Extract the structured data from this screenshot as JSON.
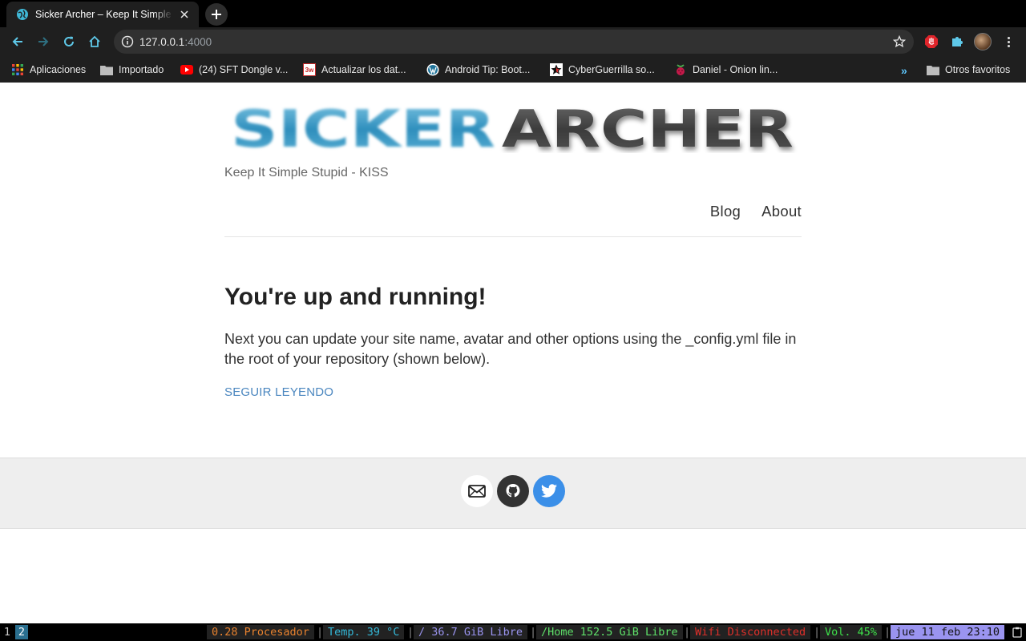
{
  "browser": {
    "tab": {
      "title": "Sicker Archer – Keep It Simple Stupid - KISS"
    },
    "omnibox": {
      "host": "127.0.0.1",
      "port": ":4000"
    },
    "bookmarks": [
      {
        "label": "Aplicaciones",
        "icon": "apps-grid-icon"
      },
      {
        "label": "Importado",
        "icon": "folder-icon"
      },
      {
        "label": "(24) SFT Dongle v...",
        "icon": "youtube-icon"
      },
      {
        "label": "Actualizar los dat...",
        "icon": "3w-icon",
        "icon_text": "3w"
      },
      {
        "label": "Android Tip: Boot...",
        "icon": "wordpress-icon"
      },
      {
        "label": "CyberGuerrilla so...",
        "icon": "star-icon"
      },
      {
        "label": "Daniel - Onion lin...",
        "icon": "raspberry-icon"
      }
    ],
    "other_bookmarks": "Otros favoritos",
    "more_bookmarks": "»"
  },
  "site": {
    "logo": {
      "part1": "SICKER",
      "part2": "ARCHER"
    },
    "tagline": "Keep It Simple Stupid - KISS",
    "nav": [
      "Blog",
      "About"
    ],
    "post": {
      "title": "You're up and running!",
      "body": "Next you can update your site name, avatar and other options using the _config.yml file in the root of your repository (shown below).",
      "read_more": "SEGUIR LEYENDO"
    },
    "social": [
      {
        "icon": "email-icon",
        "color": "#ffffff"
      },
      {
        "icon": "github-icon",
        "color": "#333333"
      },
      {
        "icon": "twitter-icon",
        "color": "#3b8fe8"
      }
    ]
  },
  "statusbar": {
    "workspaces": [
      "1",
      "2"
    ],
    "active_workspace": "2",
    "segments": [
      {
        "text": "0.28 Procesador",
        "color": "#e8822e"
      },
      {
        "text": "Temp. 39 °C",
        "color": "#34b8d8"
      },
      {
        "text": "/ 36.7 GiB Libre",
        "color": "#9a94f0"
      },
      {
        "text": "/Home 152.5 GiB Libre",
        "color": "#5fe26a"
      },
      {
        "text": "Wifi Disconnected",
        "color": "#e0302a"
      },
      {
        "text": "Vol. 45%",
        "color": "#3ee24a"
      },
      {
        "text": "jue 11 feb 23:10",
        "color": "#111111",
        "background": "#9a94f0"
      }
    ]
  },
  "colors": {
    "accent_link": "#4a86bf",
    "logo_blue": "#3f9fc8",
    "logo_gray": "#4a4a4a"
  }
}
